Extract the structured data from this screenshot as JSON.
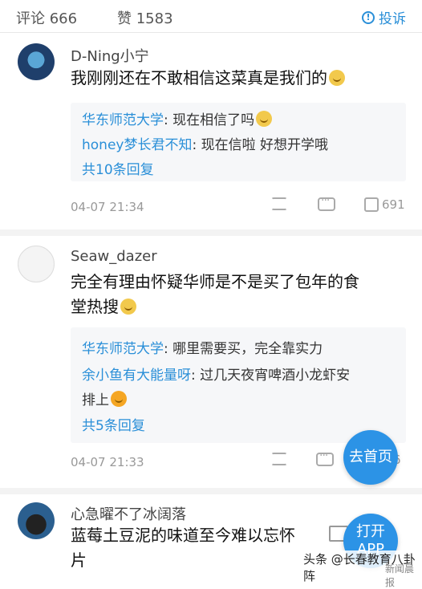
{
  "header": {
    "comments_label": "评论 666",
    "likes_label": "赞 1583",
    "report_label": "投诉",
    "report_icon": "exclamation-circle-icon"
  },
  "comments": [
    {
      "username": "D-Ning小宁",
      "content": "我刚刚还在不敢相信这菜真是我们的",
      "replies": [
        {
          "name": "华东师范大学",
          "text": ": 现在相信了吗"
        },
        {
          "name": "honey梦长君不知",
          "text": ": 现在信啦 好想开学哦"
        }
      ],
      "more_replies": "共10条回复",
      "time": "04-07 21:34",
      "likes": "691"
    },
    {
      "username": "Seaw_dazer",
      "content_line1": "完全有理由怀疑华师是不是买了包年的食",
      "content_line2": "堂热搜",
      "replies": [
        {
          "name": "华东师范大学",
          "text": ": 哪里需要买，完全靠实力"
        },
        {
          "name": "余小鱼有大能量呀",
          "text": ": 过几天夜宵啤酒小龙虾安"
        }
      ],
      "reply_continuation": "排上",
      "more_replies": "共5条回复",
      "time": "04-07 21:33",
      "likes": "6"
    },
    {
      "username": "心急曜不了冰阔落",
      "content_line1": "蓝莓土豆泥的味道至今难以忘怀",
      "content_line2": "片"
    }
  ],
  "floating": {
    "home_label": "去首页",
    "app_line1": "打开",
    "app_line2": "APP"
  },
  "watermark": {
    "text": "头条 @长春教育八卦阵",
    "sub": "新闻晨报"
  },
  "colors": {
    "accent": "#2a8fd8",
    "float_button": "#2c93e6"
  }
}
